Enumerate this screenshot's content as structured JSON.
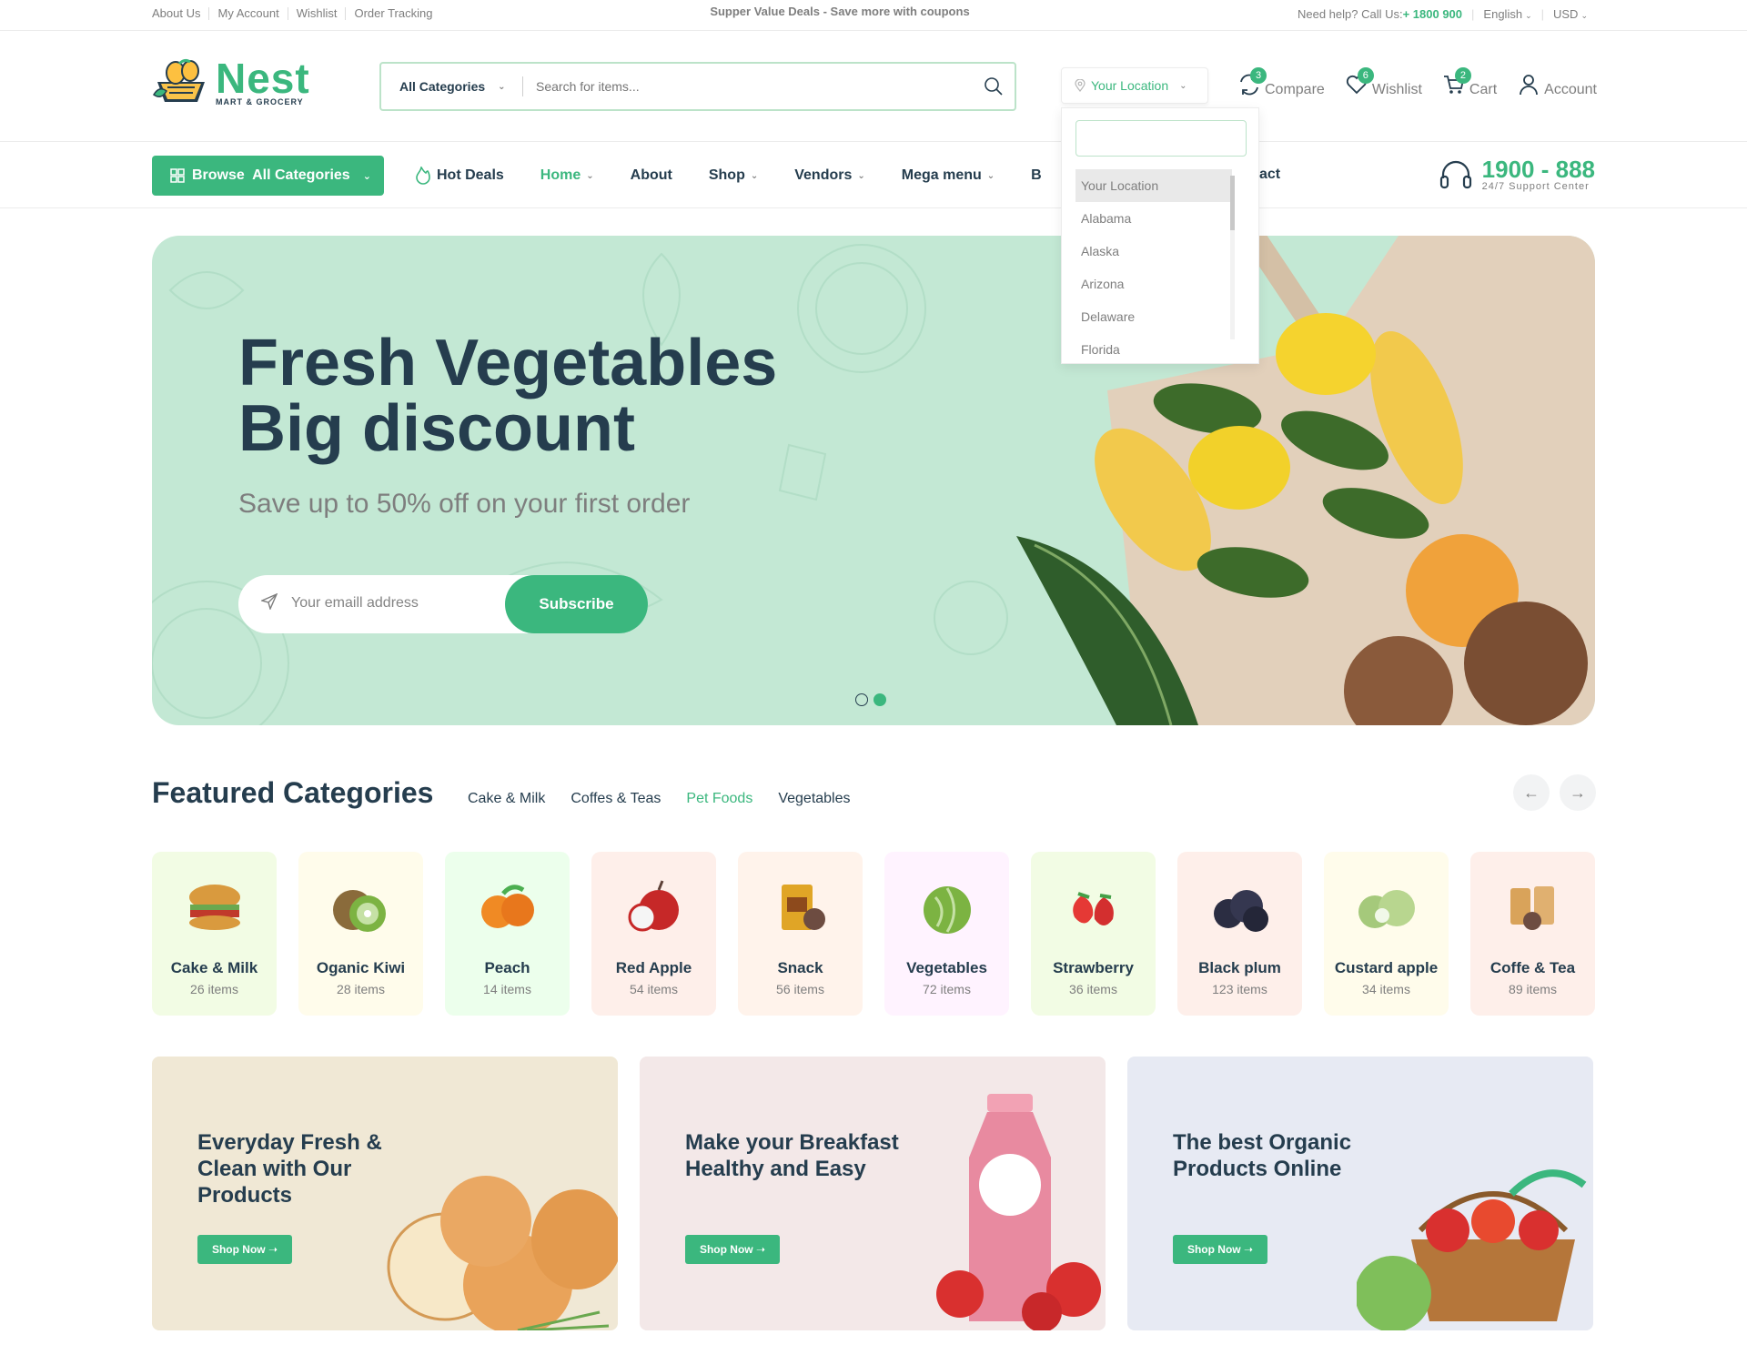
{
  "topbar": {
    "links": [
      "About Us",
      "My Account",
      "Wishlist",
      "Order Tracking"
    ],
    "promo": "Supper Value Deals - Save more with coupons",
    "help_label": "Need help? Call Us:",
    "phone": "+ 1800 900",
    "language": "English",
    "currency": "USD"
  },
  "header": {
    "logo_name": "Nest",
    "logo_sub": "MART & GROCERY",
    "search": {
      "category": "All Categories",
      "placeholder": "Search for items..."
    },
    "location": "Your Location",
    "actions": [
      {
        "label": "Compare",
        "badge": "3"
      },
      {
        "label": "Wishlist",
        "badge": "6"
      },
      {
        "label": "Cart",
        "badge": "2"
      },
      {
        "label": "Account",
        "badge": ""
      }
    ]
  },
  "location_dropdown": {
    "options": [
      "Your Location",
      "Alabama",
      "Alaska",
      "Arizona",
      "Delaware",
      "Florida"
    ],
    "selected": "Your Location"
  },
  "nav": {
    "browse_label": "Browse  All Categories",
    "hot_deals": "Hot Deals",
    "items": [
      {
        "label": "Home",
        "dropdown": true,
        "active": true
      },
      {
        "label": "About",
        "dropdown": false,
        "active": false
      },
      {
        "label": "Shop",
        "dropdown": true,
        "active": false
      },
      {
        "label": "Vendors",
        "dropdown": true,
        "active": false
      },
      {
        "label": "Mega menu",
        "dropdown": true,
        "active": false
      },
      {
        "label": "B",
        "dropdown": false,
        "active": false
      }
    ],
    "contact_tail": "act",
    "support_number": "1900 - 888",
    "support_label": "24/7 Support Center"
  },
  "hero": {
    "title_line1": "Fresh Vegetables",
    "title_line2": "Big discount",
    "subtitle": "Save up to 50% off on your first order",
    "email_placeholder": "Your emaill address",
    "subscribe": "Subscribe",
    "slides": 2,
    "active_slide": 2
  },
  "featured": {
    "title": "Featured Categories",
    "tabs": [
      "Cake & Milk",
      "Coffes & Teas",
      "Pet Foods",
      "Vegetables"
    ],
    "active_tab": "Pet Foods",
    "categories": [
      {
        "name": "Cake & Milk",
        "count": "26 items",
        "bg": "#f2fce4"
      },
      {
        "name": "Oganic Kiwi",
        "count": "28 items",
        "bg": "#fffceb"
      },
      {
        "name": "Peach",
        "count": "14 items",
        "bg": "#ecffec"
      },
      {
        "name": "Red Apple",
        "count": "54 items",
        "bg": "#feefea"
      },
      {
        "name": "Snack",
        "count": "56 items",
        "bg": "#fff3eb"
      },
      {
        "name": "Vegetables",
        "count": "72 items",
        "bg": "#fff3ff"
      },
      {
        "name": "Strawberry",
        "count": "36 items",
        "bg": "#f2fce4"
      },
      {
        "name": "Black plum",
        "count": "123 items",
        "bg": "#feefea"
      },
      {
        "name": "Custard apple",
        "count": "34 items",
        "bg": "#fffceb"
      },
      {
        "name": "Coffe & Tea",
        "count": "89 items",
        "bg": "#feefea"
      }
    ]
  },
  "banners": [
    {
      "title": "Everyday Fresh & Clean with Our Products",
      "button": "Shop Now",
      "bg": "#f0e8d5"
    },
    {
      "title": "Make your Breakfast Healthy and Easy",
      "button": "Shop Now",
      "bg": "#f3e8e8"
    },
    {
      "title": "The best Organic Products Online",
      "button": "Shop Now",
      "bg": "#e7eaf3"
    }
  ],
  "colors": {
    "brand": "#3bb77e",
    "heading": "#253d4e",
    "muted": "#7e7e7e",
    "hero_bg": "#c3e8d4"
  }
}
